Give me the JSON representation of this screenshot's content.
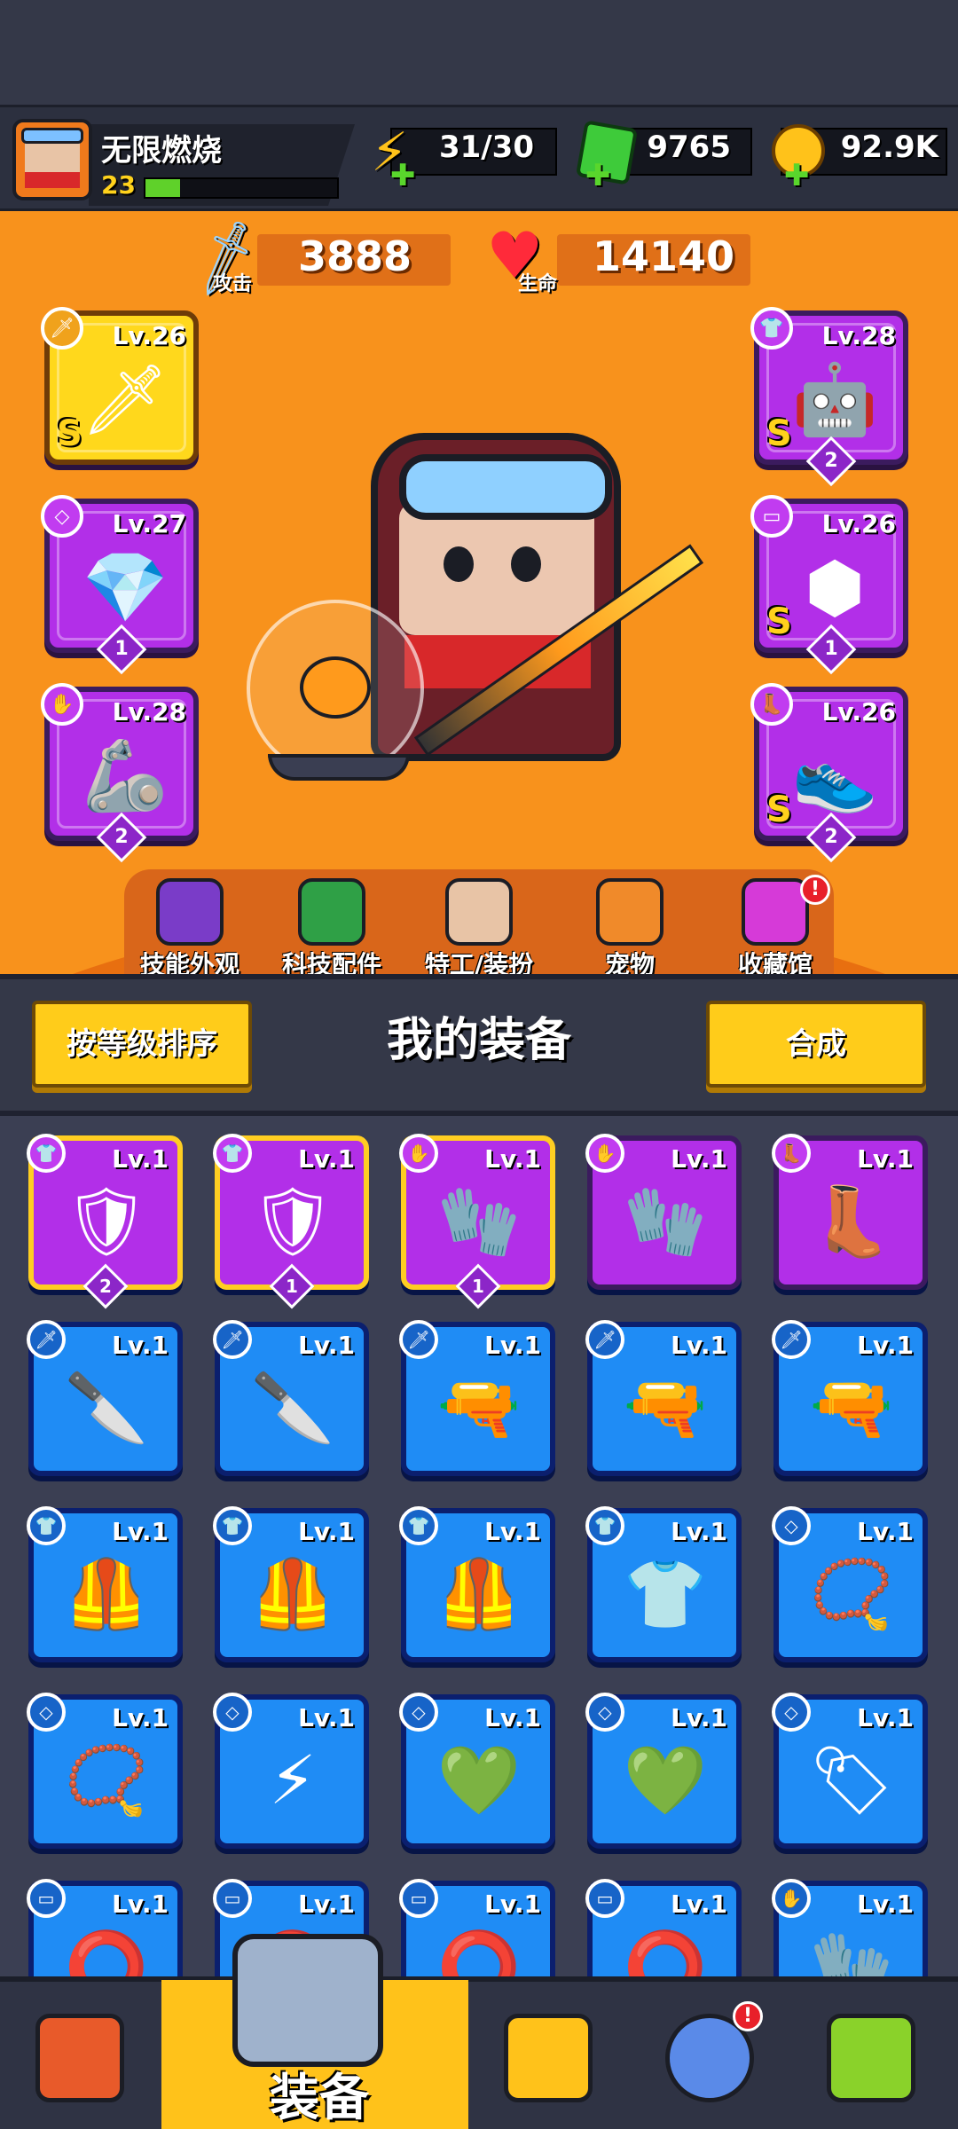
{
  "player": {
    "name": "无限燃烧",
    "level": "23",
    "xp_fraction": 0.18
  },
  "currencies": [
    {
      "icon": "energy-bolt-icon",
      "value": "31/30"
    },
    {
      "icon": "green-gem-icon",
      "value": "9765"
    },
    {
      "icon": "gold-coin-icon",
      "value": "92.9K"
    }
  ],
  "stats": {
    "attack_label": "攻击",
    "attack": "3888",
    "hp_label": "生命",
    "hp": "14140"
  },
  "equipped": [
    {
      "slot": "weapon",
      "level": "Lv.26",
      "grade": "S",
      "stars": "",
      "rarity": "gold",
      "item_icon": "flaming-sword-icon"
    },
    {
      "slot": "necklace",
      "level": "Lv.27",
      "grade": "",
      "stars": "1",
      "rarity": "purple",
      "item_icon": "emerald-necklace-icon"
    },
    {
      "slot": "gloves",
      "level": "Lv.28",
      "grade": "",
      "stars": "2",
      "rarity": "purple",
      "item_icon": "mech-gauntlet-icon"
    },
    {
      "slot": "armor",
      "level": "Lv.28",
      "grade": "S",
      "stars": "2",
      "rarity": "purple",
      "item_icon": "mech-armor-icon"
    },
    {
      "slot": "belt",
      "level": "Lv.26",
      "grade": "S",
      "stars": "1",
      "rarity": "purple",
      "item_icon": "spiked-belt-icon"
    },
    {
      "slot": "boots",
      "level": "Lv.26",
      "grade": "S",
      "stars": "2",
      "rarity": "purple",
      "item_icon": "jet-boots-icon"
    }
  ],
  "hero_tabs": [
    {
      "label": "技能外观",
      "icon": "skill-skin-icon",
      "alert": false
    },
    {
      "label": "科技配件",
      "icon": "tech-parts-icon",
      "alert": false
    },
    {
      "label": "特工/装扮",
      "icon": "agent-outfit-icon",
      "alert": false
    },
    {
      "label": "宠物",
      "icon": "pet-icon",
      "alert": false
    },
    {
      "label": "收藏馆",
      "icon": "collection-icon",
      "alert": true
    }
  ],
  "inventory": {
    "sort_button": "按等级排序",
    "title": "我的装备",
    "merge_button": "合成",
    "items": [
      {
        "level": "Lv.1",
        "rarity": "purple-gold",
        "slot": "armor",
        "stars": "2",
        "icon": "robot-chestplate-icon"
      },
      {
        "level": "Lv.1",
        "rarity": "purple-gold",
        "slot": "armor",
        "stars": "1",
        "icon": "steel-armor-icon"
      },
      {
        "level": "Lv.1",
        "rarity": "purple-gold",
        "slot": "gloves",
        "stars": "1",
        "icon": "claw-glove-icon"
      },
      {
        "level": "Lv.1",
        "rarity": "purple",
        "slot": "gloves",
        "stars": "",
        "icon": "claw-glove-icon"
      },
      {
        "level": "Lv.1",
        "rarity": "purple",
        "slot": "boots",
        "stars": "",
        "icon": "spiked-boot-icon"
      },
      {
        "level": "Lv.1",
        "rarity": "blue",
        "slot": "weapon",
        "stars": "",
        "icon": "kunai-icon"
      },
      {
        "level": "Lv.1",
        "rarity": "blue",
        "slot": "weapon",
        "stars": "",
        "icon": "kunai-icon"
      },
      {
        "level": "Lv.1",
        "rarity": "blue",
        "slot": "weapon",
        "stars": "",
        "icon": "revolver-icon"
      },
      {
        "level": "Lv.1",
        "rarity": "blue",
        "slot": "weapon",
        "stars": "",
        "icon": "revolver-icon"
      },
      {
        "level": "Lv.1",
        "rarity": "blue",
        "slot": "weapon",
        "stars": "",
        "icon": "shotgun-icon"
      },
      {
        "level": "Lv.1",
        "rarity": "blue",
        "slot": "armor",
        "stars": "",
        "icon": "red-vest-icon"
      },
      {
        "level": "Lv.1",
        "rarity": "blue",
        "slot": "armor",
        "stars": "",
        "icon": "red-vest-icon"
      },
      {
        "level": "Lv.1",
        "rarity": "blue",
        "slot": "armor",
        "stars": "",
        "icon": "tactical-vest-icon"
      },
      {
        "level": "Lv.1",
        "rarity": "blue",
        "slot": "armor",
        "stars": "",
        "icon": "camo-shirt-icon"
      },
      {
        "level": "Lv.1",
        "rarity": "blue",
        "slot": "necklace",
        "stars": "",
        "icon": "bone-necklace-icon"
      },
      {
        "level": "Lv.1",
        "rarity": "blue",
        "slot": "necklace",
        "stars": "",
        "icon": "bone-necklace-icon"
      },
      {
        "level": "Lv.1",
        "rarity": "blue",
        "slot": "necklace",
        "stars": "",
        "icon": "lightning-necklace-icon"
      },
      {
        "level": "Lv.1",
        "rarity": "blue",
        "slot": "necklace",
        "stars": "",
        "icon": "emerald-pendant-icon"
      },
      {
        "level": "Lv.1",
        "rarity": "blue",
        "slot": "necklace",
        "stars": "",
        "icon": "emerald-pendant-icon"
      },
      {
        "level": "Lv.1",
        "rarity": "blue",
        "slot": "necklace",
        "stars": "",
        "icon": "dog-tag-icon"
      },
      {
        "level": "Lv.1",
        "rarity": "blue",
        "slot": "belt",
        "stars": "",
        "icon": "leather-belt-icon"
      },
      {
        "level": "Lv.1",
        "rarity": "blue",
        "slot": "belt",
        "stars": "",
        "icon": "leather-belt-icon"
      },
      {
        "level": "Lv.1",
        "rarity": "blue",
        "slot": "belt",
        "stars": "",
        "icon": "tech-belt-icon"
      },
      {
        "level": "Lv.1",
        "rarity": "blue",
        "slot": "belt",
        "stars": "",
        "icon": "blue-belt-icon"
      },
      {
        "level": "Lv.1",
        "rarity": "blue",
        "slot": "gloves",
        "stars": "",
        "icon": "brown-glove-icon"
      }
    ]
  },
  "bottom_nav": [
    {
      "id": "shop",
      "icon": "shop-icon",
      "label": "",
      "alert": false
    },
    {
      "id": "equipment",
      "icon": "equipment-icon",
      "label": "装备",
      "alert": false,
      "selected": true
    },
    {
      "id": "battle",
      "icon": "battle-star-icon",
      "label": "",
      "alert": false
    },
    {
      "id": "events",
      "icon": "star-ball-icon",
      "label": "",
      "alert": true
    },
    {
      "id": "lab",
      "icon": "dna-capsule-icon",
      "label": "",
      "alert": false
    }
  ],
  "colors": {
    "hero_bg": "#f8921c",
    "blue_card": "#1f8cf5",
    "purple_card": "#b22fe8",
    "gold_card": "#ffd81c",
    "button_yellow": "#ffcc1a"
  }
}
